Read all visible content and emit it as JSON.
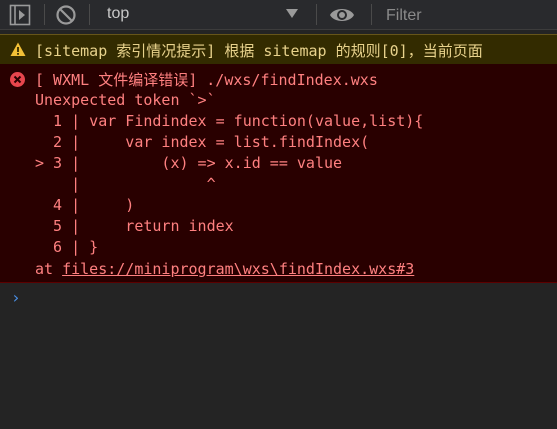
{
  "toolbar": {
    "context": "top",
    "filter_placeholder": "Filter"
  },
  "warning": {
    "text": "[sitemap 索引情况提示] 根据 sitemap 的规则[0]，当前页面"
  },
  "error": {
    "header": "[ WXML 文件编译错误] ./wxs/findIndex.wxs",
    "message": "Unexpected token `>`",
    "code": [
      "  1 | var Findindex = function(value,list){",
      "  2 |     var index = list.findIndex(",
      "> 3 |         (x) => x.id == value",
      "    |              ^",
      "  4 |     )",
      "  5 |     return index",
      "  6 | }"
    ],
    "at_prefix": "at ",
    "location": "files://miniprogram\\wxs\\findIndex.wxs#3"
  },
  "console": {
    "prompt": "›"
  }
}
